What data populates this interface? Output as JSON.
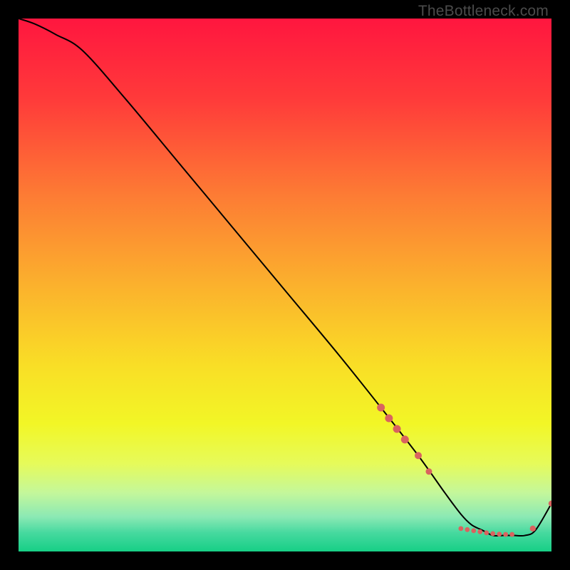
{
  "watermark": "TheBottleneck.com",
  "chart_data": {
    "type": "line",
    "title": "",
    "xlabel": "",
    "ylabel": "",
    "xlim": [
      0,
      100
    ],
    "ylim": [
      0,
      100
    ],
    "series": [
      {
        "name": "curve",
        "x": [
          0,
          3,
          7,
          12,
          20,
          30,
          40,
          50,
          60,
          68,
          75,
          80,
          83,
          85,
          87,
          89,
          91,
          93,
          95,
          97,
          100
        ],
        "y": [
          100,
          99,
          97,
          94,
          85,
          73,
          61,
          49,
          37,
          27,
          18,
          11,
          7,
          5,
          4,
          3,
          3,
          3,
          3,
          4,
          9
        ]
      }
    ],
    "markers": [
      {
        "x": 68,
        "y": 27,
        "r": 5.5
      },
      {
        "x": 69.5,
        "y": 25,
        "r": 5.5
      },
      {
        "x": 71,
        "y": 23,
        "r": 5.5
      },
      {
        "x": 72.5,
        "y": 21,
        "r": 5.5
      },
      {
        "x": 75,
        "y": 18,
        "r": 5.0
      },
      {
        "x": 77,
        "y": 15,
        "r": 4.5
      },
      {
        "x": 83,
        "y": 4.3,
        "r": 3.4
      },
      {
        "x": 84.2,
        "y": 4.1,
        "r": 3.4
      },
      {
        "x": 85.4,
        "y": 3.9,
        "r": 3.4
      },
      {
        "x": 86.6,
        "y": 3.7,
        "r": 3.4
      },
      {
        "x": 87.8,
        "y": 3.5,
        "r": 3.4
      },
      {
        "x": 89.0,
        "y": 3.35,
        "r": 3.4
      },
      {
        "x": 90.2,
        "y": 3.25,
        "r": 3.4
      },
      {
        "x": 91.4,
        "y": 3.2,
        "r": 3.4
      },
      {
        "x": 92.6,
        "y": 3.2,
        "r": 3.4
      },
      {
        "x": 96.5,
        "y": 4.3,
        "r": 4.2
      },
      {
        "x": 100,
        "y": 9,
        "r": 4.2
      }
    ],
    "marker_color": "#d9635f",
    "line_color": "#000000",
    "gradient_stops": [
      {
        "offset": 0.0,
        "color": "#ff163f"
      },
      {
        "offset": 0.15,
        "color": "#ff3a3a"
      },
      {
        "offset": 0.33,
        "color": "#fd7b34"
      },
      {
        "offset": 0.5,
        "color": "#fbb12d"
      },
      {
        "offset": 0.65,
        "color": "#f9de26"
      },
      {
        "offset": 0.76,
        "color": "#f2f626"
      },
      {
        "offset": 0.835,
        "color": "#e6fb5a"
      },
      {
        "offset": 0.89,
        "color": "#c4f79b"
      },
      {
        "offset": 0.935,
        "color": "#8be9b4"
      },
      {
        "offset": 0.965,
        "color": "#46d99f"
      },
      {
        "offset": 1.0,
        "color": "#17cf86"
      }
    ]
  }
}
